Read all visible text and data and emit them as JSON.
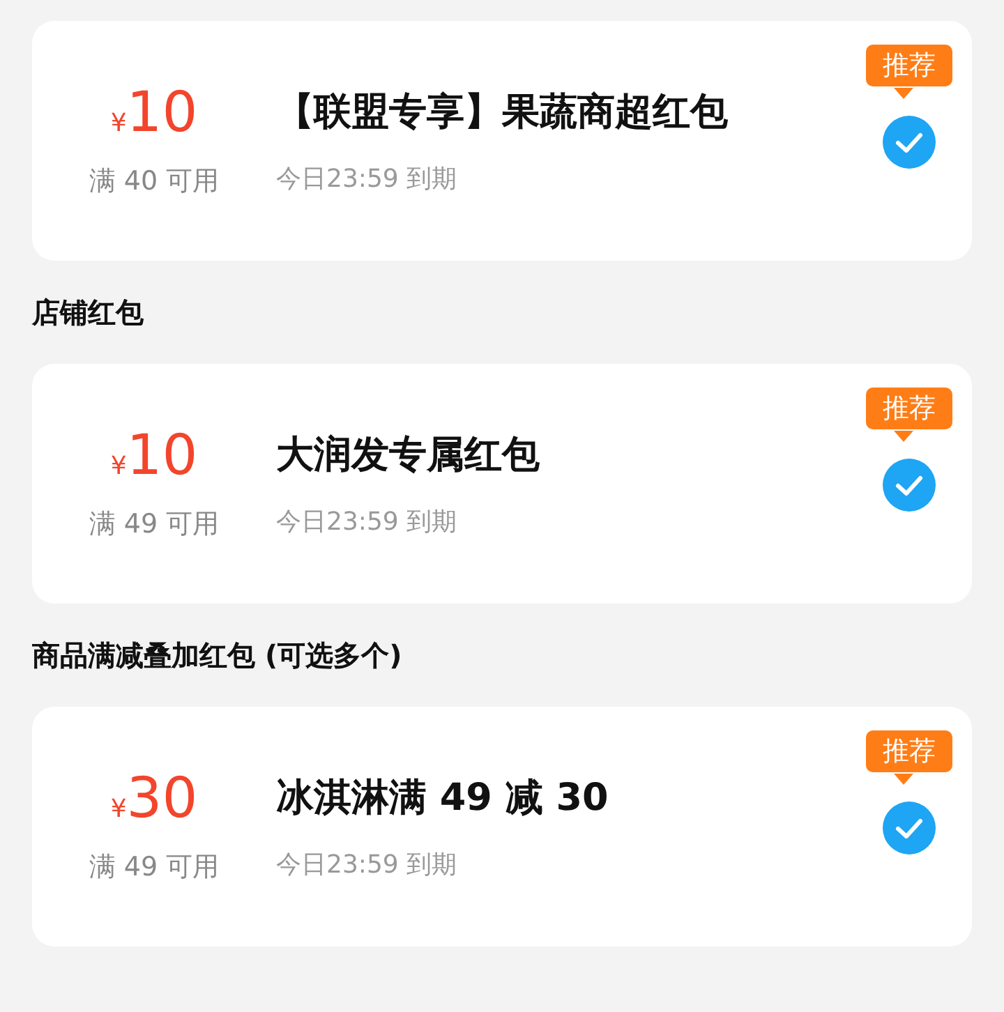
{
  "sections": [
    {
      "coupons": [
        {
          "currency": "¥",
          "amount": "10",
          "condition": "满 40 可用",
          "title": "【联盟专享】果蔬商超红包",
          "expiry": "今日23:59 到期",
          "badge": "推荐",
          "checked": true
        }
      ]
    },
    {
      "heading": "店铺红包",
      "coupons": [
        {
          "currency": "¥",
          "amount": "10",
          "condition": "满 49 可用",
          "title": "大润发专属红包",
          "expiry": "今日23:59 到期",
          "badge": "推荐",
          "checked": true
        }
      ]
    },
    {
      "heading": "商品满减叠加红包 (可选多个)",
      "coupons": [
        {
          "currency": "¥",
          "amount": "30",
          "condition": "满 49 可用",
          "title": "冰淇淋满 49 减 30",
          "expiry": "今日23:59 到期",
          "badge": "推荐",
          "checked": true
        }
      ]
    }
  ]
}
